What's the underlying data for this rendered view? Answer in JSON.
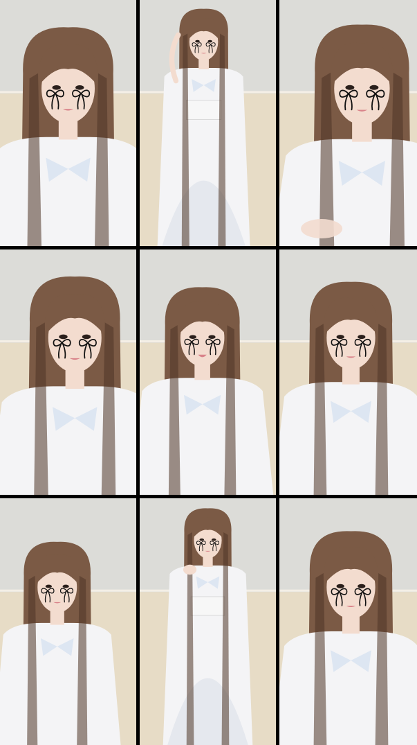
{
  "layout": {
    "rows": 3,
    "columns": 3
  },
  "palette": {
    "wall_top": "#dcdcd8",
    "wall_bottom": "#e7dcc6",
    "hair": "#7b5a45",
    "hair_shadow": "#4e3427",
    "skin": "#f3dccf",
    "blouse": "#f4f4f6",
    "bow": "#dde6f2",
    "corset": "#f7f7f7",
    "ribbon_drawing": "#111111"
  },
  "tiles": [
    {
      "id": 1,
      "pose": "close-up",
      "face": 0.5,
      "scale": 1.15,
      "arms": "none",
      "corset": false
    },
    {
      "id": 2,
      "pose": "waving",
      "face": 0.47,
      "scale": 0.62,
      "arms": "left-raised",
      "corset": true
    },
    {
      "id": 3,
      "pose": "close-up",
      "face": 0.6,
      "scale": 1.2,
      "arms": "hand-bottom",
      "corset": false
    },
    {
      "id": 4,
      "pose": "tilted-head",
      "face": 0.58,
      "scale": 1.15,
      "arms": "none",
      "corset": false
    },
    {
      "id": 5,
      "pose": "smiling",
      "face": 0.46,
      "scale": 0.95,
      "arms": "none",
      "corset": false
    },
    {
      "id": 6,
      "pose": "close-up",
      "face": 0.52,
      "scale": 1.05,
      "arms": "none",
      "corset": false
    },
    {
      "id": 7,
      "pose": "seated",
      "face": 0.42,
      "scale": 0.85,
      "arms": "none",
      "corset": false
    },
    {
      "id": 8,
      "pose": "touching-hair",
      "face": 0.5,
      "scale": 0.6,
      "arms": "left-hair",
      "corset": true
    },
    {
      "id": 9,
      "pose": "close-up",
      "face": 0.52,
      "scale": 1.05,
      "arms": "none",
      "corset": false
    }
  ]
}
